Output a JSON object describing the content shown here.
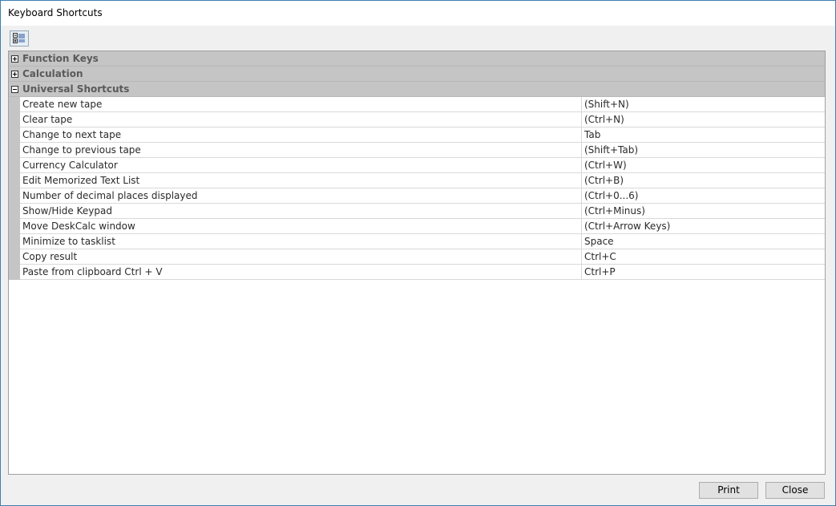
{
  "window": {
    "title": "Keyboard Shortcuts"
  },
  "toolbar": {
    "icon": "categorized-view-icon"
  },
  "categories": [
    {
      "label": "Function Keys",
      "expanded": false
    },
    {
      "label": "Calculation",
      "expanded": false
    },
    {
      "label": "Universal Shortcuts",
      "expanded": true
    }
  ],
  "shortcuts": [
    {
      "name": "Create new tape",
      "key": "(Shift+N)"
    },
    {
      "name": "Clear tape",
      "key": "(Ctrl+N)"
    },
    {
      "name": "Change to next tape",
      "key": "Tab"
    },
    {
      "name": "Change to previous tape",
      "key": "(Shift+Tab)"
    },
    {
      "name": "Currency Calculator",
      "key": "(Ctrl+W)"
    },
    {
      "name": "Edit Memorized Text List",
      "key": "(Ctrl+B)"
    },
    {
      "name": "Number of decimal places displayed",
      "key": "(Ctrl+0...6)"
    },
    {
      "name": "Show/Hide Keypad",
      "key": "(Ctrl+Minus)"
    },
    {
      "name": "Move DeskCalc window",
      "key": "(Ctrl+Arrow Keys)"
    },
    {
      "name": "Minimize to tasklist",
      "key": "Space"
    },
    {
      "name": "Copy result",
      "key": "Ctrl+C"
    },
    {
      "name": "Paste from clipboard Ctrl + V",
      "key": "Ctrl+P"
    }
  ],
  "buttons": {
    "print": "Print",
    "close": "Close"
  }
}
